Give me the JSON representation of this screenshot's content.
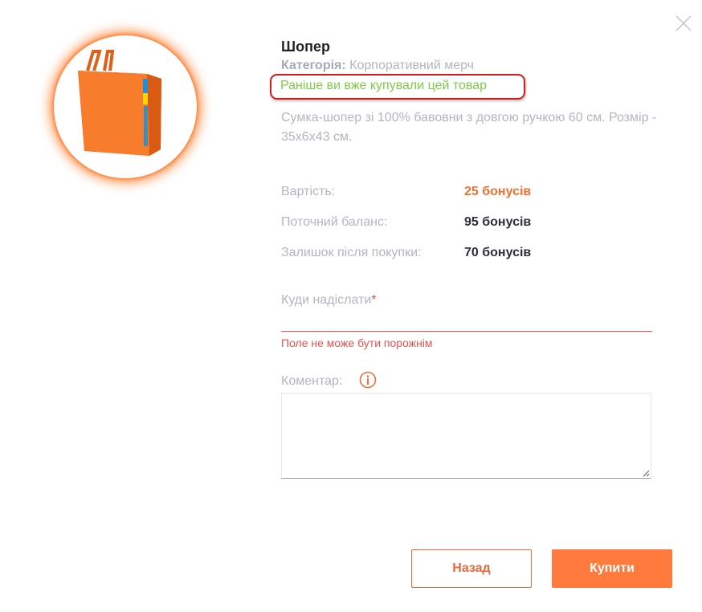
{
  "product": {
    "title": "Шопер",
    "category_label": "Категорія:",
    "category_value": "Корпоративний мерч",
    "previously_bought": "Раніше ви вже купували цей товар",
    "description": "Сумка-шопер зі 100% бавовни з довгою ручкою 60 см. Розмір - 35х6х43 см.",
    "image_icon": "orange-tote-bag",
    "bag_color": "#f37021"
  },
  "pricing": {
    "cost_label": "Вартість:",
    "cost_value": "25 бонусів",
    "balance_label": "Поточний баланс:",
    "balance_value": "95 бонусів",
    "remaining_label": "Залишок після покупки:",
    "remaining_value": "70 бонусів"
  },
  "form": {
    "address_label": "Куди надіслати",
    "required_mark": "*",
    "address_value": "",
    "address_error": "Поле не може бути порожнім",
    "comment_label": "Коментар:",
    "comment_value": ""
  },
  "buttons": {
    "back": "Назад",
    "buy": "Купити"
  },
  "colors": {
    "accent": "#ff7a3d",
    "price": "#f07030",
    "success": "#7fca4a",
    "error": "#e5534b",
    "highlight_border": "#d61a1a"
  }
}
